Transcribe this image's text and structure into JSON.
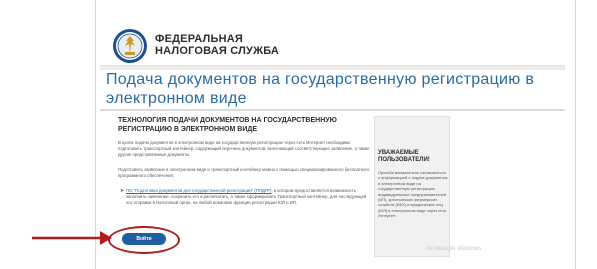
{
  "header": {
    "org_line1": "ФЕДЕРАЛЬНАЯ",
    "org_line2": "НАЛОГОВАЯ СЛУЖБА",
    "logo_icon": "fns-emblem-icon"
  },
  "page_title": "Подача документов на государственную регистрацию в электронном виде",
  "main": {
    "section_title": "ТЕХНОЛОГИЯ ПОДАЧИ ДОКУМЕНТОВ НА ГОСУДАРСТВЕННУЮ РЕГИСТРАЦИЮ В ЭЛЕКТРОННОМ ВИДЕ",
    "paragraph1": "В целях подачи документов в электронном виде на государственную регистрацию через сеть Интернет необходимо подготовить транспортный контейнер, содержащий перечень документов, включающий соответствующее заявление, а также другие представляемые документы.",
    "paragraph2": "Подготовить заявление в электронном виде и транспортный контейнер можно с помощью специализированного бесплатного программного обеспечения:",
    "list_item_link": "ПО \"Подготовка документов для государственной регистрации\" (ППДГР)",
    "list_item_rest": ", в котором предоставляется возможность заполнить заявление, сохранить его и распечатать, а также сформировать Транспортный контейнер, для последующей его отправки в Налоговый орган, на любой возможно функции регистрации ЮЛ и ИП."
  },
  "login_button": "Войти",
  "notice": {
    "title": "УВАЖАЕМЫЕ ПОЛЬЗОВАТЕЛИ!",
    "text": "Просьба внимательно ознакомиться с информацией о подаче документов в электронном виде на государственную регистрацию индивидуальных предпринимателей (ИП), крестьянских фермерских хозяйств (КФХ) и юридических лиц (ЮЛ) в электронном виде через сеть Интернет."
  },
  "watermark": "Активация Windows",
  "colors": {
    "title_blue": "#2a6aa3",
    "button_blue": "#1f5fa0",
    "annotation_red": "#b21c1c"
  }
}
